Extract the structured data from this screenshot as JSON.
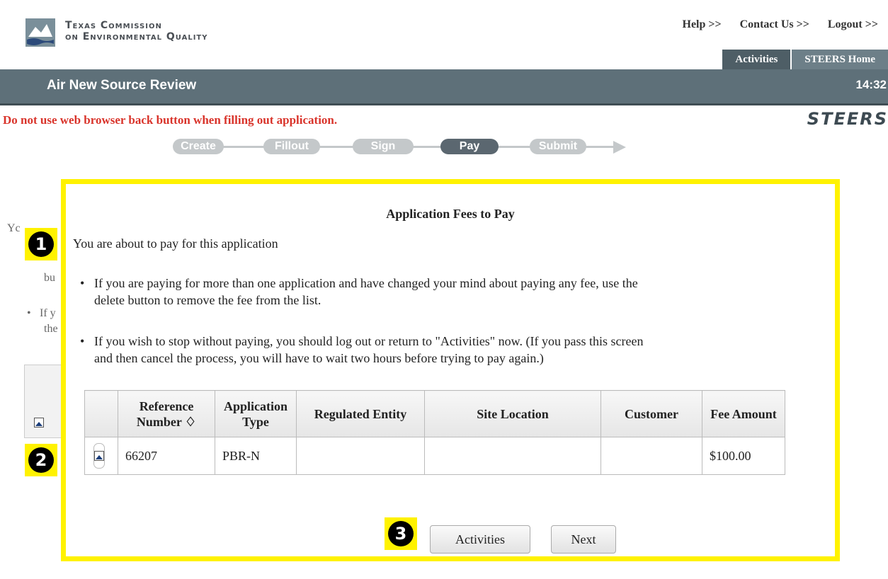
{
  "header": {
    "org_line1": "Texas Commission",
    "org_line2": "on Environmental Quality",
    "links": [
      "Help >>",
      "Contact Us >>",
      "Logout >>"
    ],
    "nav_tabs": [
      "Activities",
      "STEERS Home"
    ],
    "app_title": "Air New Source Review",
    "time": "14:32",
    "logo_text": "STEERS"
  },
  "warning": "Do not use web browser back button when filling out application.",
  "progress_steps": [
    "Create",
    "Fillout",
    "Sign",
    "Pay",
    "Submit"
  ],
  "active_step": "Pay",
  "background": {
    "text_fragments": [
      "Yc",
      "bu",
      "If y",
      "the"
    ]
  },
  "modal": {
    "title": "Application Fees to Pay",
    "intro": "You are about to pay for this application",
    "bullet1_line1": "If you are paying for more than one application and have changed your mind about paying any fee, use the",
    "bullet1_line2": "delete button to remove the fee from the list.",
    "bullet2_line1": "If you wish to stop without paying, you should log out or return to \"Activities\" now. (If you pass this screen",
    "bullet2_line2": "and then cancel the process, you will have to wait two hours before trying to pay again.)",
    "table": {
      "headers": {
        "ref": "Reference Number ♢",
        "type": "Application Type",
        "entity": "Regulated Entity",
        "site": "Site Location",
        "customer": "Customer",
        "fee": "Fee Amount"
      },
      "row": {
        "ref": "66207",
        "type": "PBR-N",
        "entity": "",
        "site": "",
        "customer": "",
        "fee": "$100.00"
      }
    },
    "buttons": {
      "activities": "Activities",
      "next": "Next"
    }
  },
  "markers": [
    "1",
    "2",
    "3"
  ],
  "colors": {
    "highlight": "#fff200",
    "header_bar": "#5e7079",
    "warning": "#d9342b",
    "active_step": "#5b6770"
  }
}
